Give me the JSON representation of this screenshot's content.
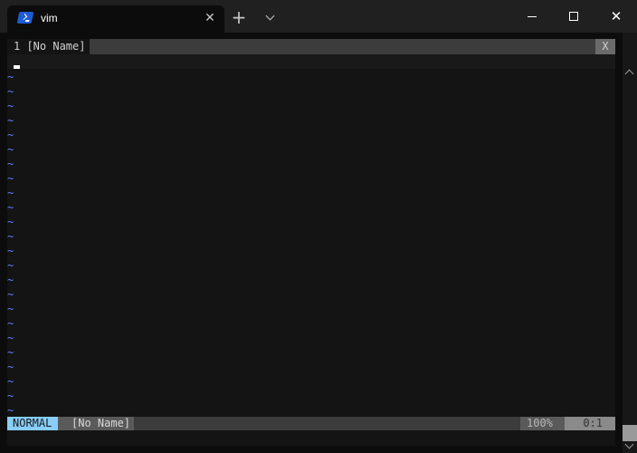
{
  "window": {
    "tab_title": "vim",
    "tab_icon": "powershell-icon",
    "new_tab_symbol": "+",
    "close_tab_symbol": "✕",
    "close_window_symbol": "✕"
  },
  "vim": {
    "tabline": {
      "tab_label": "1 [No Name]",
      "close_label": "X"
    },
    "tilde_char": "~",
    "tilde_line_count": 24,
    "statusline": {
      "mode": "NORMAL",
      "filename": "[No Name]",
      "percent": "100%",
      "position": "0:1"
    },
    "colors": {
      "mode_bg": "#87cefa",
      "tilde": "#5f7fff",
      "background": "#141414"
    }
  }
}
